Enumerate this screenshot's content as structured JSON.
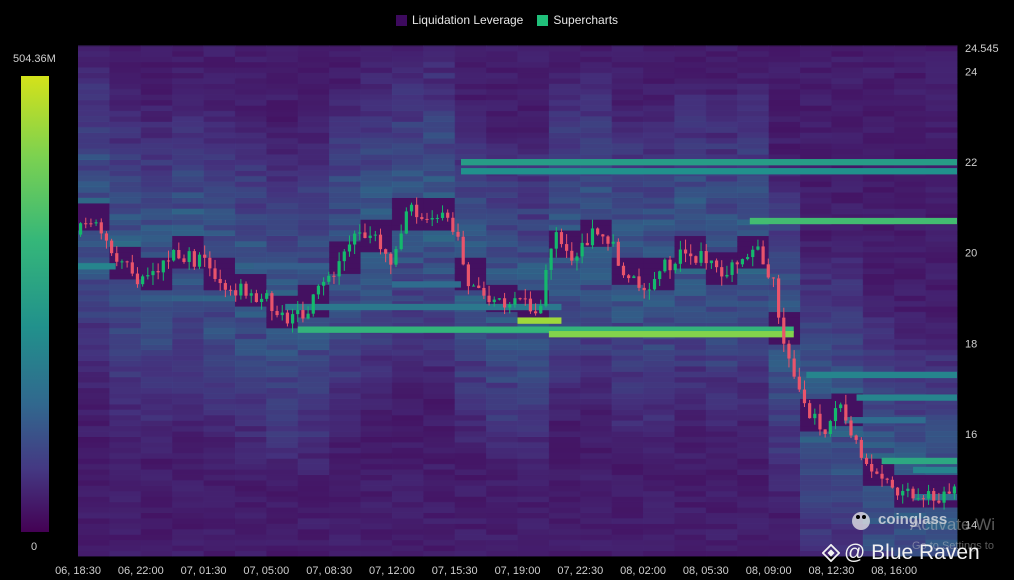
{
  "legend": {
    "items": [
      {
        "label": "Liquidation Leverage",
        "color": "#3d0a5e"
      },
      {
        "label": "Supercharts",
        "color": "#20c07a"
      }
    ]
  },
  "colorbar": {
    "max_label": "504.36M",
    "min_label": "0",
    "colors": [
      "#440154",
      "#443983",
      "#31688e",
      "#21918c",
      "#35b779",
      "#7ad151",
      "#d4e21a"
    ]
  },
  "watermarks": {
    "brand": "coinglass",
    "activate": "Activate Wi",
    "goto": "Go to Settings to",
    "author": "@ Blue Raven"
  },
  "chart_data": {
    "type": "heatmap",
    "title": "",
    "x_ticks": [
      "06, 18:30",
      "06, 22:00",
      "07, 01:30",
      "07, 05:00",
      "07, 08:30",
      "07, 12:00",
      "07, 15:30",
      "07, 19:00",
      "07, 22:30",
      "08, 02:00",
      "08, 05:30",
      "08, 09:00",
      "08, 12:30",
      "08, 16:00"
    ],
    "y_ticks": [
      14,
      16,
      18,
      20,
      22,
      24
    ],
    "y_top_label": "24.545",
    "ylim": [
      13.3,
      24.545
    ],
    "x_index_range": [
      0,
      14
    ],
    "liquidation_bands": [
      {
        "price": 22.0,
        "start": 6.1,
        "end": 14,
        "intensity": 0.55
      },
      {
        "price": 21.8,
        "start": 6.1,
        "end": 14,
        "intensity": 0.5
      },
      {
        "price": 20.7,
        "start": 10.7,
        "end": 14,
        "intensity": 0.7
      },
      {
        "price": 18.5,
        "start": 7.0,
        "end": 7.7,
        "intensity": 0.9
      },
      {
        "price": 18.3,
        "start": 3.5,
        "end": 11.4,
        "intensity": 0.65
      },
      {
        "price": 18.2,
        "start": 7.5,
        "end": 11.4,
        "intensity": 0.85
      },
      {
        "price": 19.7,
        "start": 0,
        "end": 0.6,
        "intensity": 0.45
      },
      {
        "price": 19.7,
        "start": 2.8,
        "end": 4.0,
        "intensity": 0.3
      },
      {
        "price": 19.3,
        "start": 5.0,
        "end": 6.1,
        "intensity": 0.35
      },
      {
        "price": 18.8,
        "start": 3.3,
        "end": 7.7,
        "intensity": 0.4
      },
      {
        "price": 17.3,
        "start": 11.6,
        "end": 14,
        "intensity": 0.45
      },
      {
        "price": 16.8,
        "start": 12.4,
        "end": 14,
        "intensity": 0.45
      },
      {
        "price": 16.3,
        "start": 12.2,
        "end": 13.5,
        "intensity": 0.35
      },
      {
        "price": 15.4,
        "start": 12.8,
        "end": 14,
        "intensity": 0.6
      },
      {
        "price": 15.2,
        "start": 13.3,
        "end": 14,
        "intensity": 0.45
      },
      {
        "price": 14.6,
        "start": 13.3,
        "end": 14,
        "intensity": 0.35
      }
    ],
    "price_path": {
      "x": [
        0,
        0.3,
        0.6,
        0.9,
        1.2,
        1.6,
        2.0,
        2.4,
        2.8,
        3.1,
        3.3,
        3.6,
        3.9,
        4.2,
        4.5,
        4.8,
        5.0,
        5.3,
        5.6,
        5.9,
        6.1,
        6.3,
        6.6,
        6.9,
        7.2,
        7.4,
        7.6,
        7.9,
        8.2,
        8.5,
        8.8,
        9.1,
        9.4,
        9.7,
        10.0,
        10.3,
        10.6,
        10.9,
        11.1,
        11.3,
        11.5,
        11.7,
        11.9,
        12.2,
        12.5,
        12.8,
        13.1,
        13.4,
        13.7,
        14.0
      ],
      "y": [
        20.4,
        20.8,
        20.0,
        19.5,
        19.4,
        20.0,
        19.8,
        19.3,
        19.1,
        18.9,
        18.6,
        18.6,
        19.2,
        19.7,
        20.5,
        20.3,
        19.8,
        21.0,
        20.6,
        21.0,
        20.3,
        19.2,
        19.0,
        18.9,
        18.9,
        18.6,
        20.4,
        19.9,
        20.4,
        20.3,
        19.4,
        19.3,
        19.7,
        20.0,
        19.9,
        19.6,
        19.9,
        20.0,
        19.4,
        17.9,
        16.9,
        16.5,
        16.0,
        16.6,
        15.6,
        15.0,
        14.6,
        14.7,
        14.6,
        14.8
      ],
      "up_color": "#14b86c",
      "down_color": "#e9546b"
    },
    "colorbar_range": [
      "0",
      "504.36M"
    ],
    "legend": [
      "Liquidation Leverage",
      "Supercharts"
    ]
  }
}
